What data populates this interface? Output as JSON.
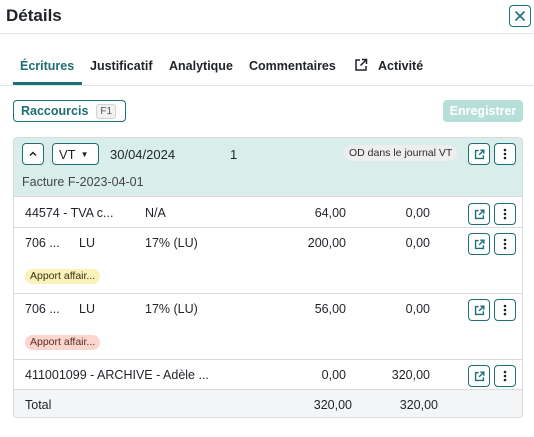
{
  "panel": {
    "title": "Détails",
    "close_icon": "close-icon"
  },
  "tabs": [
    {
      "label": "Écritures",
      "active": true
    },
    {
      "label": "Justificatif",
      "active": false
    },
    {
      "label": "Analytique",
      "active": false
    },
    {
      "label": "Commentaires",
      "active": false
    },
    {
      "label": "Activité",
      "active": false,
      "icon": "external-link-icon"
    }
  ],
  "toolbar": {
    "shortcuts_label": "Raccourcis",
    "shortcuts_key": "F1",
    "save_label": "Enregistrer",
    "save_disabled": true
  },
  "entry": {
    "journal": "VT",
    "date": "30/04/2024",
    "number": "1",
    "badge": "OD dans le journal VT",
    "label": "Facture F-2023-04-01"
  },
  "lines": [
    {
      "account": "44574 - TVA c...",
      "auxiliary": "",
      "tax": "N/A",
      "debit": "64,00",
      "credit": "0,00",
      "tag": ""
    },
    {
      "account": "706 ...",
      "auxiliary": "LU",
      "tax": "17% (LU)",
      "debit": "200,00",
      "credit": "0,00",
      "tag": "Apport affair..."
    },
    {
      "account": "706 ...",
      "auxiliary": "LU",
      "tax": "17% (LU)",
      "debit": "56,00",
      "credit": "0,00",
      "tag": "Apport affair..."
    },
    {
      "account": "411001099 - ARCHIVE - Adèle ...",
      "auxiliary": "",
      "tax": "",
      "debit": "0,00",
      "credit": "320,00",
      "tag": ""
    }
  ],
  "totals": {
    "label": "Total",
    "debit": "320,00",
    "credit": "320,00"
  },
  "colors": {
    "accent": "#1d6f73",
    "header_bg": "#d9eeeb",
    "save_disabled": "#b7dfd9",
    "tag_yellow": "#faf2b8",
    "tag_red": "#fbd6cf"
  }
}
